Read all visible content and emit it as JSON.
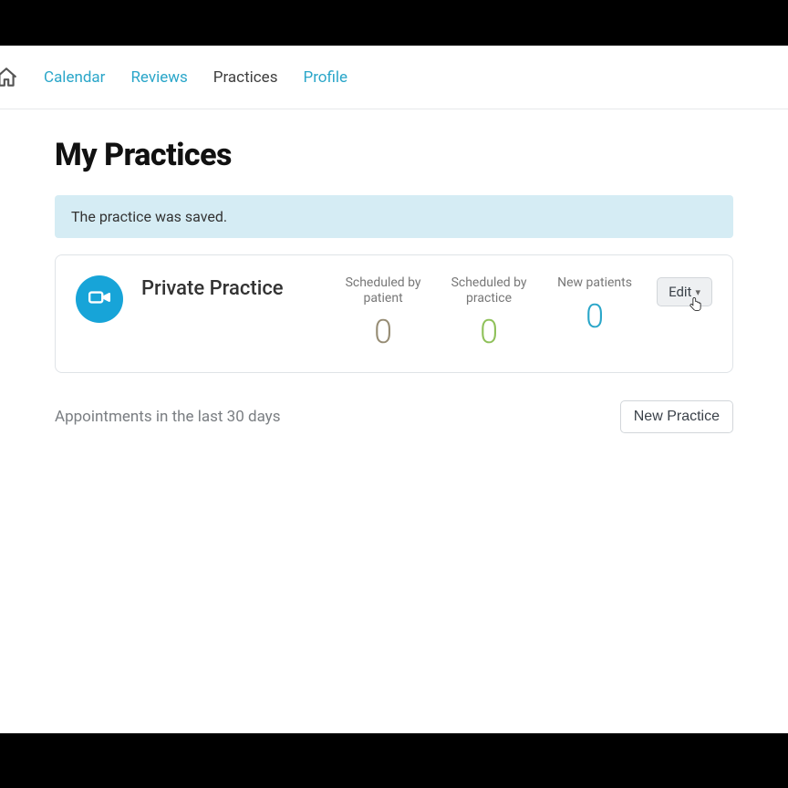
{
  "nav": {
    "items": [
      "Calendar",
      "Reviews",
      "Practices",
      "Profile"
    ],
    "active_index": 2
  },
  "page": {
    "title": "My Practices",
    "alert": "The practice was saved.",
    "hint": "Appointments in the last 30 days"
  },
  "practice": {
    "name": "Private Practice",
    "stats": [
      {
        "label": "Scheduled by\npatient",
        "value": "0",
        "colorClass": "v-brown"
      },
      {
        "label": "Scheduled by\npractice",
        "value": "0",
        "colorClass": "v-green"
      },
      {
        "label": "New patients",
        "value": "0",
        "colorClass": "v-blue"
      }
    ],
    "edit_label": "Edit"
  },
  "buttons": {
    "new_practice": "New Practice"
  },
  "colors": {
    "accent": "#2aa6c9",
    "alert_bg": "#d5ecf4"
  }
}
